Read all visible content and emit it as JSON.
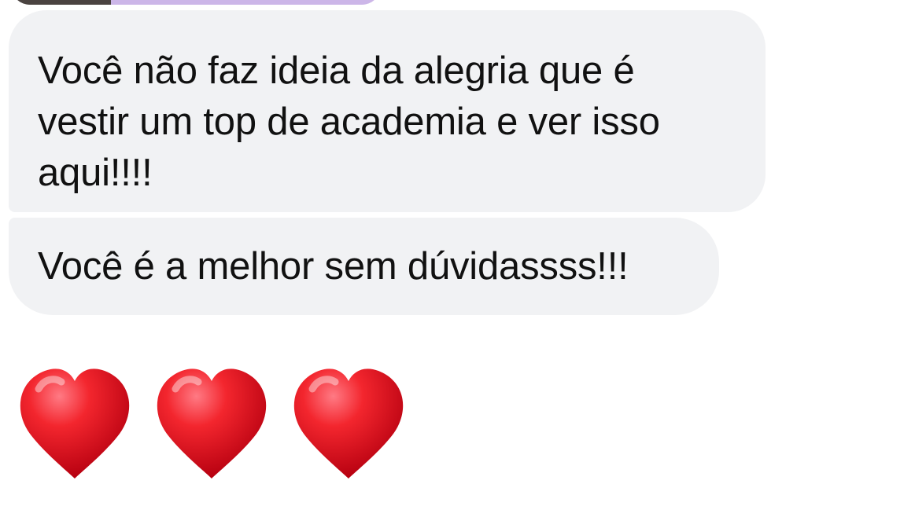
{
  "messages": [
    {
      "text": "Você não faz ideia da alegria que é\nvestir um top de academia e ver isso\naqui!!!!"
    },
    {
      "text": "Você é a melhor sem dúvidassss!!!"
    }
  ],
  "reaction": {
    "emoji": [
      "heart-icon",
      "heart-icon",
      "heart-icon"
    ],
    "color": "#e11d2e"
  },
  "colors": {
    "bubble_background": "#f1f2f4",
    "text": "#111111",
    "attachment_accent": "#ccb6e8"
  }
}
